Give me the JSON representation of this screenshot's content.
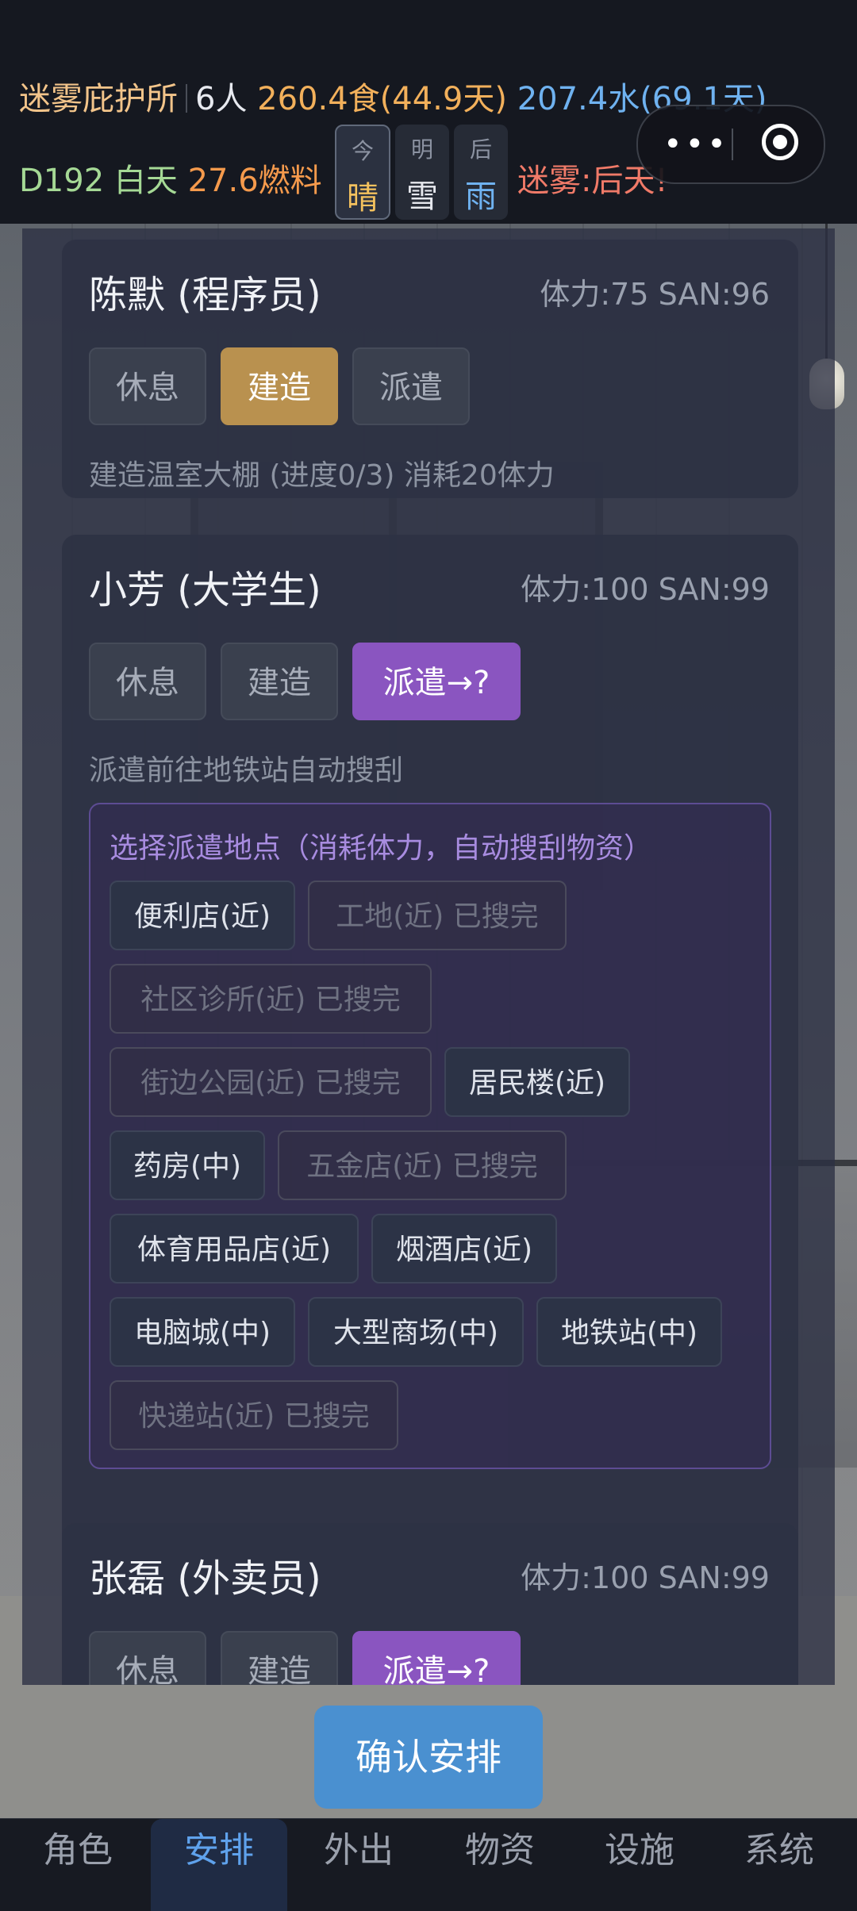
{
  "status": {
    "shelter_name": "迷雾庇护所",
    "population": "6人",
    "food": "260.4食(44.9天)",
    "water": "207.4水(69.1天)",
    "day": "D192",
    "time_of_day": "白天",
    "fuel": "27.6燃料",
    "fog_warning": "迷雾:后天!"
  },
  "forecast": [
    {
      "day": "今",
      "weather": "晴"
    },
    {
      "day": "明",
      "weather": "雪"
    },
    {
      "day": "后",
      "weather": "雨"
    }
  ],
  "characters": [
    {
      "name": "陈默 (程序员)",
      "stats": "体力:75  SAN:96",
      "actions": [
        "休息",
        "建造",
        "派遣"
      ],
      "selected": "建造",
      "desc": "建造温室大棚 (进度0/3) 消耗20体力"
    },
    {
      "name": "小芳 (大学生)",
      "stats": "体力:100  SAN:99",
      "actions": [
        "休息",
        "建造",
        "派遣→?"
      ],
      "selected": "派遣→?",
      "desc": "派遣前往地铁站自动搜刮"
    },
    {
      "name": "张磊 (外卖员)",
      "stats": "体力:100  SAN:99",
      "actions": [
        "休息",
        "建造",
        "派遣→?"
      ],
      "selected": "派遣→?"
    }
  ],
  "dispatch": {
    "title": "选择派遣地点（消耗体力，自动搜刮物资）",
    "locations": [
      {
        "label": "便利店(近)",
        "available": true
      },
      {
        "label": "工地(近) 已搜完",
        "available": false
      },
      {
        "label": "社区诊所(近) 已搜完",
        "available": false
      },
      {
        "label": "街边公园(近) 已搜完",
        "available": false
      },
      {
        "label": "居民楼(近)",
        "available": true
      },
      {
        "label": "药房(中)",
        "available": true
      },
      {
        "label": "五金店(近) 已搜完",
        "available": false
      },
      {
        "label": "体育用品店(近)",
        "available": true
      },
      {
        "label": "烟酒店(近)",
        "available": true
      },
      {
        "label": "电脑城(中)",
        "available": true
      },
      {
        "label": "大型商场(中)",
        "available": true
      },
      {
        "label": "地铁站(中)",
        "available": true
      },
      {
        "label": "快递站(近) 已搜完",
        "available": false
      }
    ]
  },
  "confirm_label": "确认安排",
  "tabs": [
    "角色",
    "安排",
    "外出",
    "物资",
    "设施",
    "系统"
  ],
  "selected_tab": "安排",
  "colors": {
    "accent_blue": "#4a90d0",
    "build_gold": "#b9914f",
    "dispatch_purple": "#8a55c0"
  }
}
